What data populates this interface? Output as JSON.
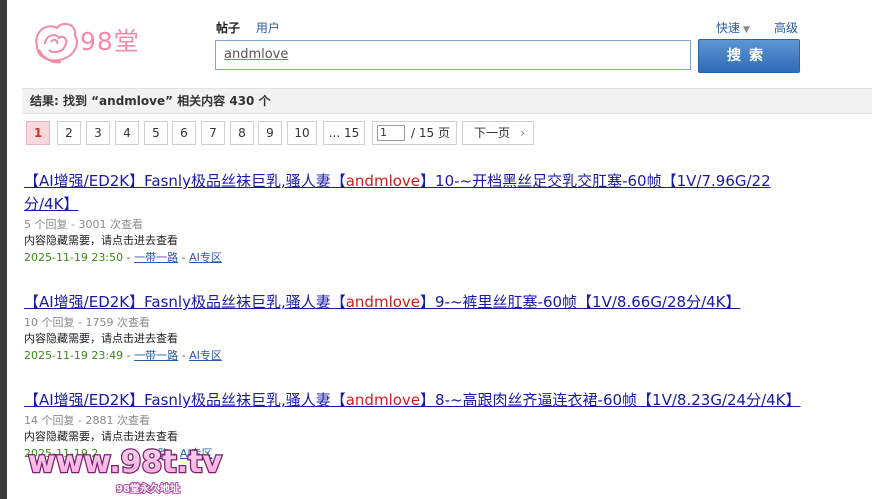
{
  "header": {
    "logo_text": "98堂",
    "tabs": [
      {
        "label": "帖子",
        "active": true
      },
      {
        "label": "用户",
        "active": false
      }
    ],
    "quick_label": "快速",
    "advanced_label": "高级",
    "search_value": "andmlove",
    "search_button": "搜索"
  },
  "summary": {
    "prefix": "结果: 找到 “",
    "keyword": "andmlove",
    "suffix": "” 相关内容 430 个"
  },
  "pager": {
    "pages": [
      "1",
      "2",
      "3",
      "4",
      "5",
      "6",
      "7",
      "8",
      "9",
      "10",
      "... 15"
    ],
    "current": "1",
    "input_value": "1",
    "total_text": "/ 15 页",
    "next_label": "下一页"
  },
  "results": [
    {
      "title_pre": "【AI增强/ED2K】Fasnly极品丝袜巨乳,骚人妻【",
      "title_hl": "andmlove",
      "title_post": "】10-~开档黑丝足交乳交肛塞-60帧【1V/7.96G/22分/4K】",
      "meta": "5 个回复 - 3001 次查看",
      "desc": "内容隐藏需要，请点击进去查看",
      "date": "2025-11-19 23:50",
      "author": "一带一路",
      "forum": "AI专区"
    },
    {
      "title_pre": "【AI增强/ED2K】Fasnly极品丝袜巨乳,骚人妻【",
      "title_hl": "andmlove",
      "title_post": "】9-~裤里丝肛塞-60帧【1V/8.66G/28分/4K】",
      "meta": "10 个回复 - 1759 次查看",
      "desc": "内容隐藏需要，请点击进去查看",
      "date": "2025-11-19 23:49",
      "author": "一带一路",
      "forum": "AI专区"
    },
    {
      "title_pre": "【AI增强/ED2K】Fasnly极品丝袜巨乳,骚人妻【",
      "title_hl": "andmlove",
      "title_post": "】8-~高跟肉丝齐逼连衣裙-60帧【1V/8.23G/24分/4K】",
      "meta": "14 个回复 - 2881 次查看",
      "desc": "内容隐藏需要，请点击进去查看",
      "date": "2025-11-19 2",
      "author": "路",
      "forum": "AI专区"
    }
  ],
  "watermark": {
    "text": "www.98t.tv",
    "sub": "98堂永久地址"
  },
  "colors": {
    "accent_blue": "#2f6bb7",
    "highlight_red": "#d41c1c",
    "date_green": "#3a8a18",
    "logo_pink": "#f48aa5"
  }
}
